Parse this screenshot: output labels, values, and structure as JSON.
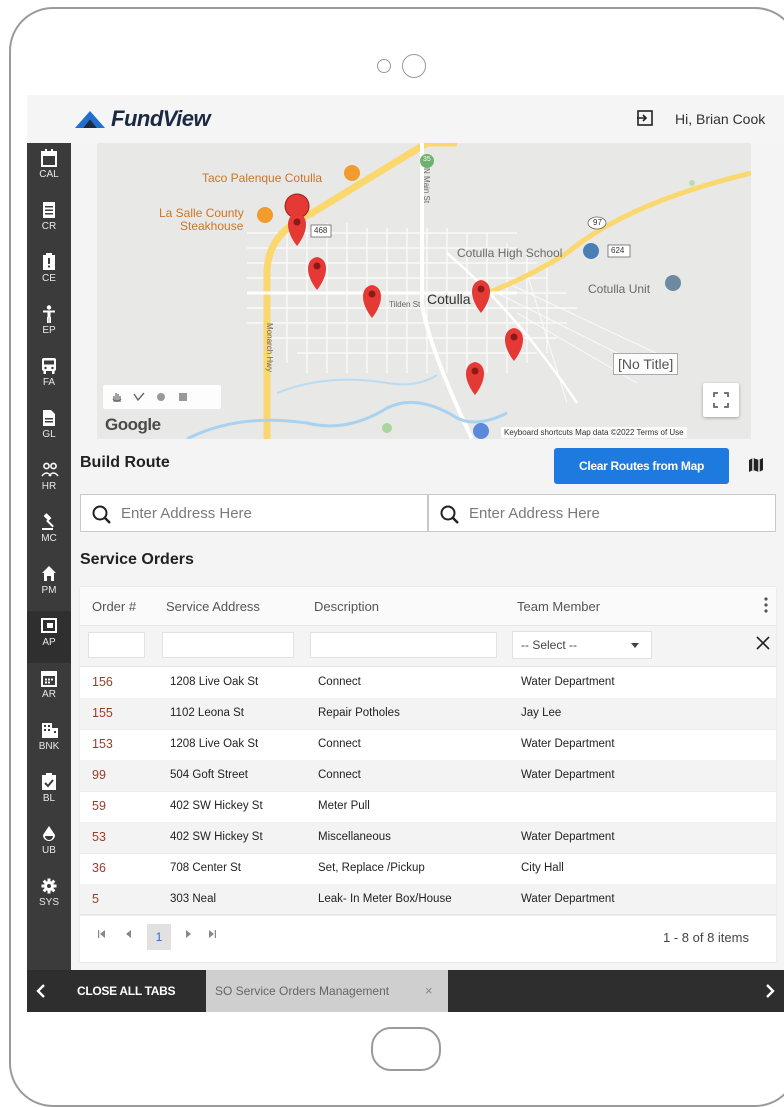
{
  "header": {
    "brand": "FundView",
    "greeting": "Hi, Brian Cook"
  },
  "nav": [
    {
      "label": "CAL",
      "icon": "calendar-icon"
    },
    {
      "label": "CR",
      "icon": "document-list-icon"
    },
    {
      "label": "CE",
      "icon": "alert-clipboard-icon"
    },
    {
      "label": "EP",
      "icon": "person-icon"
    },
    {
      "label": "FA",
      "icon": "bus-icon"
    },
    {
      "label": "GL",
      "icon": "file-icon"
    },
    {
      "label": "HR",
      "icon": "people-icon"
    },
    {
      "label": "MC",
      "icon": "gavel-icon"
    },
    {
      "label": "PM",
      "icon": "home-icon"
    },
    {
      "label": "AP",
      "icon": "payment-icon"
    },
    {
      "label": "AR",
      "icon": "calendar-grid-icon"
    },
    {
      "label": "BNK",
      "icon": "bank-icon"
    },
    {
      "label": "BL",
      "icon": "clipboard-check-icon"
    },
    {
      "label": "UB",
      "icon": "droplet-icon"
    },
    {
      "label": "SYS",
      "icon": "gear-icon"
    }
  ],
  "map": {
    "labels": {
      "taco": "Taco Palenque Cotulla",
      "lasalle1": "La Salle County",
      "lasalle2": "Steakhouse",
      "highschool": "Cotulla High School",
      "unit": "Cotulla Unit",
      "city": "Cotulla",
      "tilden": "Tilden St",
      "monarch": "Monarch Hwy",
      "nmain": "N Main St",
      "r468": "468",
      "r624": "624",
      "r97": "97",
      "r35": "35"
    },
    "no_title": "[No Title]",
    "google": "Google",
    "footer": "Keyboard shortcuts   Map data ©2022   Terms of Use"
  },
  "build_route": {
    "title": "Build Route",
    "clear_button": "Clear Routes from Map",
    "address_placeholder_1": "Enter Address Here",
    "address_placeholder_2": "Enter Address Here"
  },
  "service_orders": {
    "title": "Service Orders",
    "columns": [
      "Order #",
      "Service Address",
      "Description",
      "Team Member"
    ],
    "select_placeholder": "-- Select --",
    "rows": [
      {
        "order": "156",
        "address": "1208 Live Oak St",
        "description": "Connect",
        "team": "Water  Department"
      },
      {
        "order": "155",
        "address": "1102 Leona St",
        "description": "Repair Potholes",
        "team": "Jay Lee"
      },
      {
        "order": "153",
        "address": "1208 Live Oak St",
        "description": "Connect",
        "team": "Water  Department"
      },
      {
        "order": "99",
        "address": "504 Goft  Street",
        "description": "Connect",
        "team": "Water  Department"
      },
      {
        "order": "59",
        "address": "402 SW Hickey St",
        "description": "Meter Pull",
        "team": ""
      },
      {
        "order": "53",
        "address": "402 SW Hickey St",
        "description": "Miscellaneous",
        "team": "Water  Department"
      },
      {
        "order": "36",
        "address": "708 Center St",
        "description": "Set, Replace /Pickup",
        "team": "City  Hall"
      },
      {
        "order": "5",
        "address": "303 Neal",
        "description": "Leak- In Meter Box/House",
        "team": "Water  Department"
      }
    ],
    "pager": {
      "current_page": "1",
      "count_text": "1 - 8 of 8 items"
    }
  },
  "tabs": {
    "close_all": "CLOSE ALL TABS",
    "open_tab": "SO Service Orders Management",
    "close_glyph": "×"
  },
  "colors": {
    "accent": "#1f7ae0",
    "nav_bg": "#3b3b3b",
    "order_link": "#9a3c2c",
    "pin": "#e53935"
  }
}
